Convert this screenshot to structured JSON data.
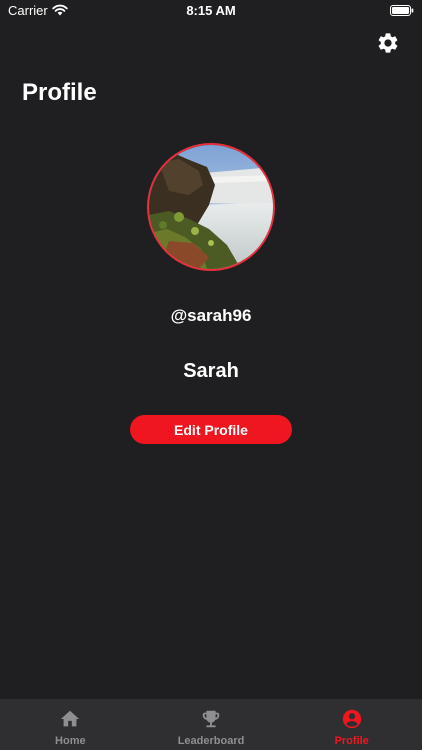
{
  "status_bar": {
    "carrier": "Carrier",
    "time": "8:15 AM"
  },
  "header": {
    "title": "Profile",
    "settings_icon": "gear-icon"
  },
  "profile": {
    "avatar_icon": "waterfall-photo",
    "username": "@sarah96",
    "display_name": "Sarah",
    "edit_button_label": "Edit Profile"
  },
  "tab_bar": {
    "active": "Profile",
    "tabs": [
      {
        "label": "Home",
        "icon": "home-icon"
      },
      {
        "label": "Leaderboard",
        "icon": "trophy-icon"
      },
      {
        "label": "Profile",
        "icon": "user-circle-icon"
      }
    ]
  },
  "colors": {
    "background": "#1f1f21",
    "accent": "#f0161f",
    "tab_bar": "#2f2f31",
    "inactive": "#8e8e93"
  }
}
